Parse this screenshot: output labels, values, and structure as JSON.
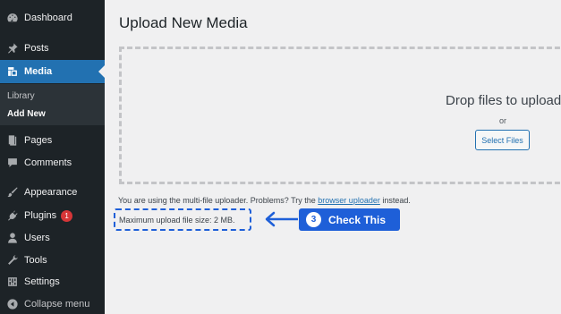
{
  "sidebar": {
    "items": [
      {
        "label": "Dashboard",
        "icon": "dashboard-icon"
      },
      {
        "label": "Posts",
        "icon": "pin-icon"
      },
      {
        "label": "Media",
        "icon": "media-icon"
      },
      {
        "label": "Pages",
        "icon": "pages-icon"
      },
      {
        "label": "Comments",
        "icon": "comment-icon"
      },
      {
        "label": "Appearance",
        "icon": "brush-icon"
      },
      {
        "label": "Plugins",
        "icon": "plugin-icon",
        "badge": "1"
      },
      {
        "label": "Users",
        "icon": "user-icon"
      },
      {
        "label": "Tools",
        "icon": "wrench-icon"
      },
      {
        "label": "Settings",
        "icon": "settings-icon"
      },
      {
        "label": "Collapse menu",
        "icon": "collapse-icon"
      }
    ],
    "submenu": [
      {
        "label": "Library"
      },
      {
        "label": "Add New",
        "current": true
      }
    ]
  },
  "main": {
    "title": "Upload New Media",
    "drop_text": "Drop files to upload",
    "or_text": "or",
    "select_button": "Select Files",
    "info_prefix": "You are using the multi-file uploader. Problems? Try the ",
    "info_link": "browser uploader",
    "info_suffix": " instead.",
    "max_upload": "Maximum upload file size: 2 MB."
  },
  "callout": {
    "number": "3",
    "text": "Check This"
  },
  "colors": {
    "sidebar_bg": "#1d2327",
    "accent": "#2271b1",
    "callout": "#1e5fd8",
    "badge": "#d63638"
  }
}
